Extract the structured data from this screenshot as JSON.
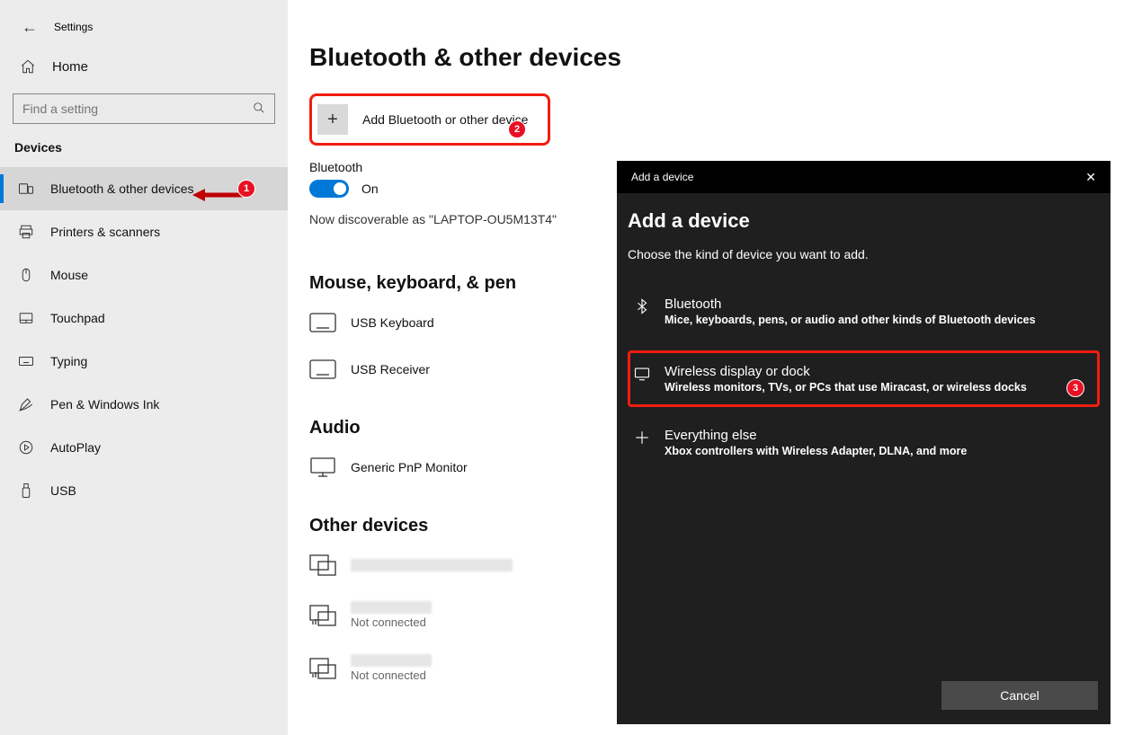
{
  "window_title": "Settings",
  "sidebar": {
    "home_label": "Home",
    "search_placeholder": "Find a setting",
    "group_header": "Devices",
    "items": [
      {
        "label": "Bluetooth & other devices",
        "active": true
      },
      {
        "label": "Printers & scanners"
      },
      {
        "label": "Mouse"
      },
      {
        "label": "Touchpad"
      },
      {
        "label": "Typing"
      },
      {
        "label": "Pen & Windows Ink"
      },
      {
        "label": "AutoPlay"
      },
      {
        "label": "USB"
      }
    ]
  },
  "page": {
    "title": "Bluetooth & other devices",
    "add_button_label": "Add Bluetooth or other device",
    "bluetooth_label": "Bluetooth",
    "bluetooth_state": "On",
    "discoverable_text": "Now discoverable as \"LAPTOP-OU5M13T4\"",
    "sections": {
      "mkp": {
        "title": "Mouse, keyboard, & pen",
        "items": [
          "USB Keyboard",
          "USB Receiver"
        ]
      },
      "audio": {
        "title": "Audio",
        "items": [
          "Generic PnP Monitor"
        ]
      },
      "other": {
        "title": "Other devices",
        "not_connected": "Not connected"
      }
    }
  },
  "dialog": {
    "titlebar": "Add a device",
    "heading": "Add a device",
    "sub": "Choose the kind of device you want to add.",
    "options": [
      {
        "title": "Bluetooth",
        "desc": "Mice, keyboards, pens, or audio and other kinds of Bluetooth devices"
      },
      {
        "title": "Wireless display or dock",
        "desc": "Wireless monitors, TVs, or PCs that use Miracast, or wireless docks"
      },
      {
        "title": "Everything else",
        "desc": "Xbox controllers with Wireless Adapter, DLNA, and more"
      }
    ],
    "cancel": "Cancel"
  },
  "annotations": {
    "b1": "1",
    "b2": "2",
    "b3": "3"
  }
}
